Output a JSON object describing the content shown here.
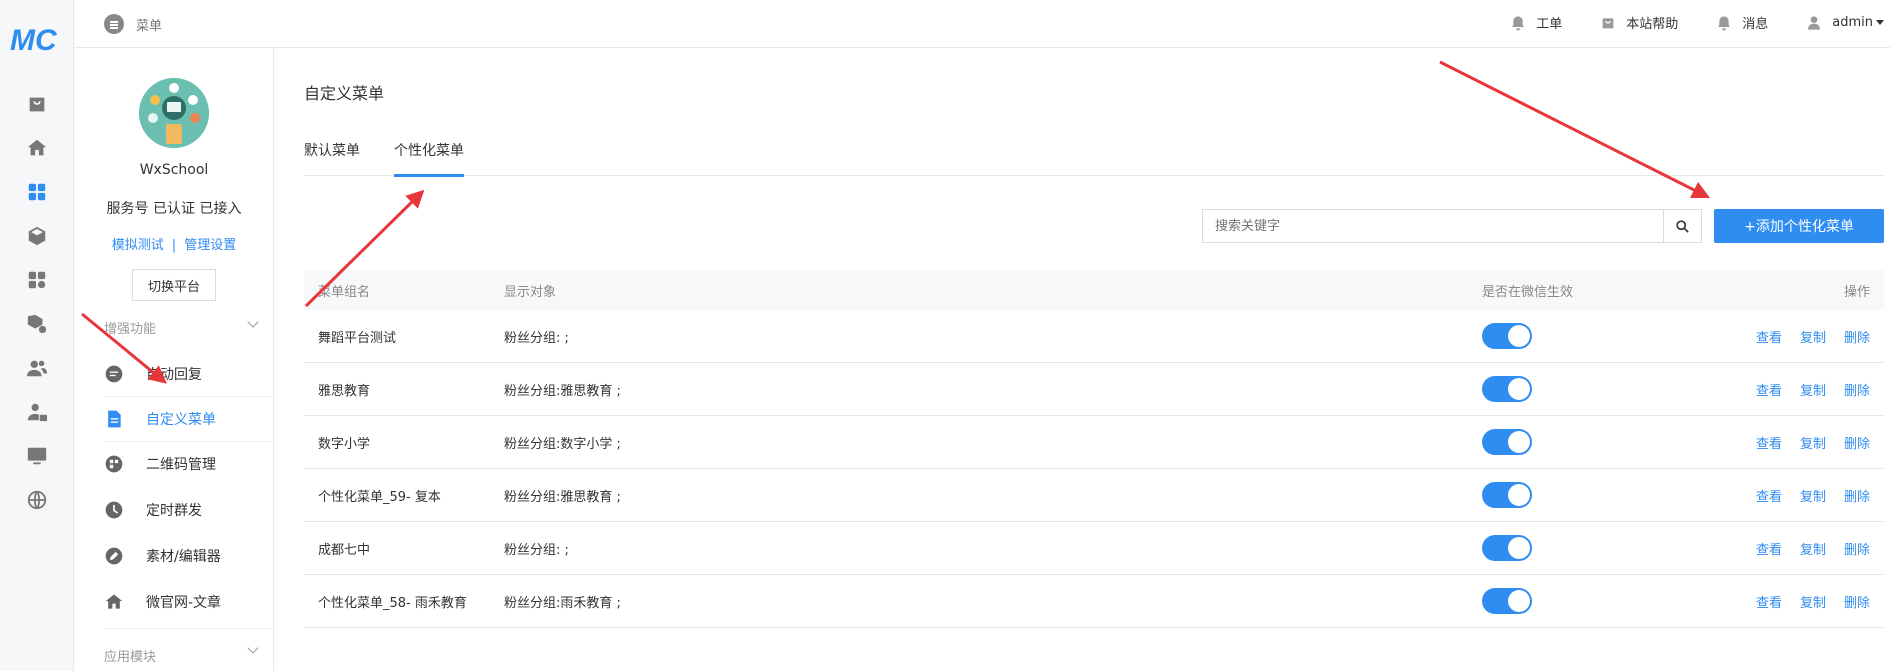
{
  "rail": {
    "logo_text": "MC",
    "items": [
      {
        "icon": "bag-icon"
      },
      {
        "icon": "home-icon"
      },
      {
        "icon": "apps-grid-icon",
        "active": true
      },
      {
        "icon": "cube-icon"
      },
      {
        "icon": "apps-settings-icon"
      },
      {
        "icon": "cube-settings-icon"
      },
      {
        "icon": "users-icon"
      },
      {
        "icon": "user-lock-icon"
      },
      {
        "icon": "monitor-icon"
      },
      {
        "icon": "globe-icon"
      }
    ]
  },
  "topbar": {
    "breadcrumb": "菜单",
    "links": [
      {
        "label": "工单",
        "icon": "bell-icon"
      },
      {
        "label": "本站帮助",
        "icon": "bag-icon"
      },
      {
        "label": "消息",
        "icon": "bell-icon"
      },
      {
        "label": "admin",
        "icon": "user-icon"
      }
    ]
  },
  "sidebar": {
    "account_name": "WxSchool",
    "account_status": "服务号 已认证 已接入",
    "link_simulate": "模拟测试",
    "link_separator": "|",
    "link_manage": "管理设置",
    "switch_platform": "切换平台",
    "group_enhance": "增强功能",
    "group_apps": "应用模块",
    "items": [
      {
        "label": "自动回复",
        "icon": "chat-icon"
      },
      {
        "label": "自定义菜单",
        "icon": "document-icon",
        "active": true
      },
      {
        "label": "二维码管理",
        "icon": "qrcode-icon"
      },
      {
        "label": "定时群发",
        "icon": "clock-icon"
      },
      {
        "label": "素材/编辑器",
        "icon": "pencil-icon"
      },
      {
        "label": "微官网-文章",
        "icon": "home-icon"
      }
    ]
  },
  "main": {
    "title": "自定义菜单",
    "tabs": [
      {
        "label": "默认菜单",
        "active": false
      },
      {
        "label": "个性化菜单",
        "active": true
      }
    ],
    "search_placeholder": "搜索关键字",
    "add_button": "+添加个性化菜单",
    "table": {
      "headers": {
        "name": "菜单组名",
        "target": "显示对象",
        "active": "是否在微信生效",
        "ops": "操作"
      },
      "ops": [
        "查看",
        "复制",
        "删除"
      ],
      "rows": [
        {
          "name": "舞蹈平台测试",
          "target": "粉丝分组: ;",
          "active": true
        },
        {
          "name": "雅思教育",
          "target": "粉丝分组:雅思教育 ;",
          "active": true
        },
        {
          "name": "数字小学",
          "target": "粉丝分组:数字小学 ;",
          "active": true
        },
        {
          "name": "个性化菜单_59- 复本",
          "target": "粉丝分组:雅思教育 ;",
          "active": true
        },
        {
          "name": "成都七中",
          "target": "粉丝分组: ;",
          "active": true
        },
        {
          "name": "个性化菜单_58- 雨禾教育",
          "target": "粉丝分组:雨禾教育 ;",
          "active": true
        }
      ]
    }
  },
  "colors": {
    "accent": "#2f8cf0",
    "annotation_arrow": "#e8373a"
  }
}
